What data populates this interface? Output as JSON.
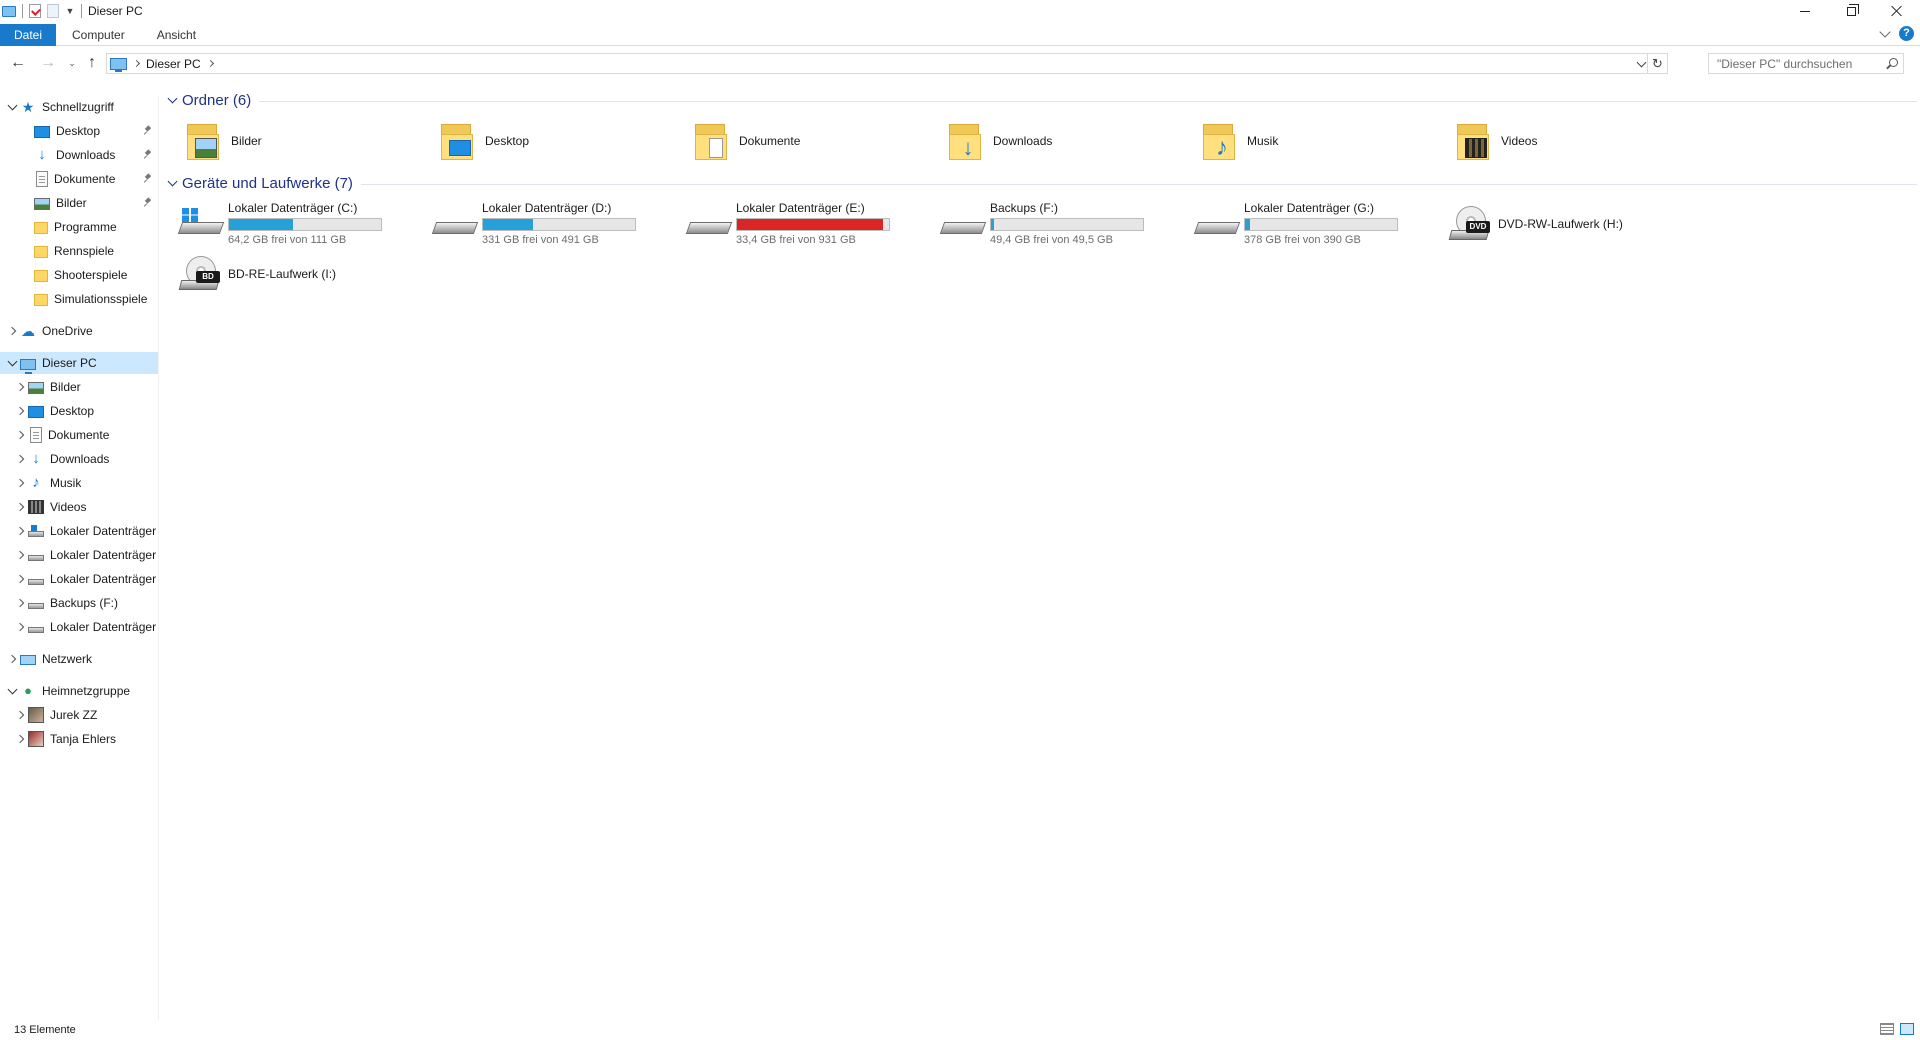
{
  "window": {
    "title": "Dieser PC",
    "minimize_icon": "minimize-icon",
    "maximize_icon": "restore-icon",
    "close_icon": "close-icon"
  },
  "ribbon": {
    "tabs": [
      {
        "label": "Datei",
        "active": true
      },
      {
        "label": "Computer",
        "active": false
      },
      {
        "label": "Ansicht",
        "active": false
      }
    ],
    "help_label": "?"
  },
  "address": {
    "path": [
      "Dieser PC"
    ],
    "search_placeholder": "\"Dieser PC\" durchsuchen"
  },
  "sidebar": {
    "quick_access": {
      "label": "Schnellzugriff",
      "items": [
        {
          "label": "Desktop",
          "icon": "desktop-icon",
          "pinned": true
        },
        {
          "label": "Downloads",
          "icon": "downloads-icon",
          "pinned": true
        },
        {
          "label": "Dokumente",
          "icon": "documents-icon",
          "pinned": true
        },
        {
          "label": "Bilder",
          "icon": "pictures-icon",
          "pinned": true
        },
        {
          "label": "Programme",
          "icon": "folder-icon",
          "pinned": false
        },
        {
          "label": "Rennspiele",
          "icon": "folder-icon",
          "pinned": false
        },
        {
          "label": "Shooterspiele",
          "icon": "folder-icon",
          "pinned": false
        },
        {
          "label": "Simulationsspiele",
          "icon": "folder-icon",
          "pinned": false
        }
      ]
    },
    "onedrive": {
      "label": "OneDrive"
    },
    "this_pc": {
      "label": "Dieser PC",
      "items": [
        {
          "label": "Bilder",
          "icon": "pictures-icon"
        },
        {
          "label": "Desktop",
          "icon": "desktop-icon"
        },
        {
          "label": "Dokumente",
          "icon": "documents-icon"
        },
        {
          "label": "Downloads",
          "icon": "downloads-icon"
        },
        {
          "label": "Musik",
          "icon": "music-icon"
        },
        {
          "label": "Videos",
          "icon": "videos-icon"
        },
        {
          "label": "Lokaler Datenträger",
          "icon": "system-drive-icon"
        },
        {
          "label": "Lokaler Datenträger",
          "icon": "drive-icon"
        },
        {
          "label": "Lokaler Datenträger",
          "icon": "drive-icon"
        },
        {
          "label": "Backups (F:)",
          "icon": "drive-icon"
        },
        {
          "label": "Lokaler Datenträger",
          "icon": "drive-icon"
        }
      ]
    },
    "network": {
      "label": "Netzwerk"
    },
    "homegroup": {
      "label": "Heimnetzgruppe",
      "items": [
        {
          "label": "Jurek ZZ",
          "icon": "user-avatar-icon"
        },
        {
          "label": "Tanja Ehlers",
          "icon": "user-avatar-icon"
        }
      ]
    }
  },
  "main": {
    "folders_header": "Ordner (6)",
    "folders": [
      {
        "name": "Bilder",
        "icon": "pictures-folder-icon"
      },
      {
        "name": "Desktop",
        "icon": "desktop-folder-icon"
      },
      {
        "name": "Dokumente",
        "icon": "documents-folder-icon"
      },
      {
        "name": "Downloads",
        "icon": "downloads-folder-icon"
      },
      {
        "name": "Musik",
        "icon": "music-folder-icon"
      },
      {
        "name": "Videos",
        "icon": "videos-folder-icon"
      }
    ],
    "devices_header": "Geräte und Laufwerke (7)",
    "drives": [
      {
        "name": "Lokaler Datenträger (C:)",
        "free_text": "64,2 GB frei von 111 GB",
        "used_fraction": 0.42,
        "bar_color": "#26a0da",
        "system": true
      },
      {
        "name": "Lokaler Datenträger (D:)",
        "free_text": "331 GB frei von 491 GB",
        "used_fraction": 0.33,
        "bar_color": "#26a0da",
        "system": false
      },
      {
        "name": "Lokaler Datenträger (E:)",
        "free_text": "33,4 GB frei von 931 GB",
        "used_fraction": 0.96,
        "bar_color": "#da2626",
        "system": false
      },
      {
        "name": "Backups (F:)",
        "free_text": "49,4 GB frei von 49,5 GB",
        "used_fraction": 0.002,
        "bar_color": "#26a0da",
        "system": false
      },
      {
        "name": "Lokaler Datenträger (G:)",
        "free_text": "378 GB frei von 390 GB",
        "used_fraction": 0.03,
        "bar_color": "#26a0da",
        "system": false
      }
    ],
    "discs": [
      {
        "name": "DVD-RW-Laufwerk (H:)",
        "tag": "DVD",
        "icon": "dvd-drive-icon"
      },
      {
        "name": "BD-RE-Laufwerk (I:)",
        "tag": "BD",
        "icon": "bluray-drive-icon"
      }
    ]
  },
  "status": {
    "items_text": "13 Elemente"
  },
  "colors": {
    "accent": "#1979ca",
    "selection": "#cce8ff",
    "group_header": "#1e3287",
    "drive_bar_normal": "#26a0da",
    "drive_bar_full": "#da2626"
  }
}
